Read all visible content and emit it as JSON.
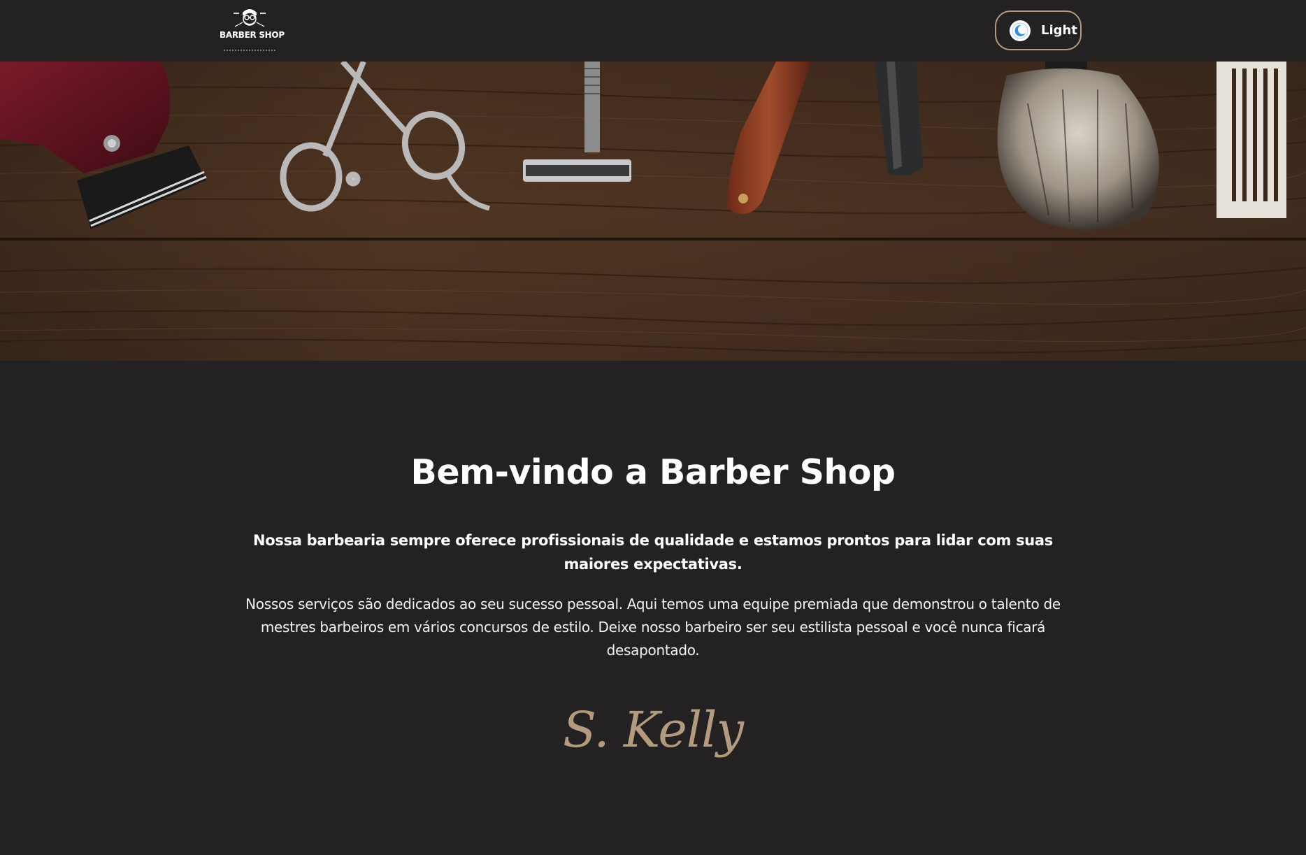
{
  "header": {
    "logo": {
      "text": "BARBER SHOP",
      "alt": "Barber Shop logo"
    },
    "theme_toggle": {
      "label": "Light",
      "icon": "moon-icon"
    }
  },
  "hero": {
    "image_alt": "Barber tools on a dark wooden table"
  },
  "main": {
    "title": "Bem-vindo a Barber Shop",
    "lead": "Nossa barbearia sempre oferece profissionais de qualidade e estamos prontos para lidar com suas maiores expectativas.",
    "body": "Nossos serviços são dedicados ao seu sucesso pessoal. Aqui temos uma equipe premiada que demonstrou o talento de mestres barbeiros em vários concursos de estilo. Deixe nosso barbeiro ser seu estilista pessoal e você nunca ficará desapontado.",
    "signature": "S. Kelly"
  },
  "colors": {
    "background": "#232122",
    "accent": "#b49b7e",
    "text": "#ffffff"
  }
}
